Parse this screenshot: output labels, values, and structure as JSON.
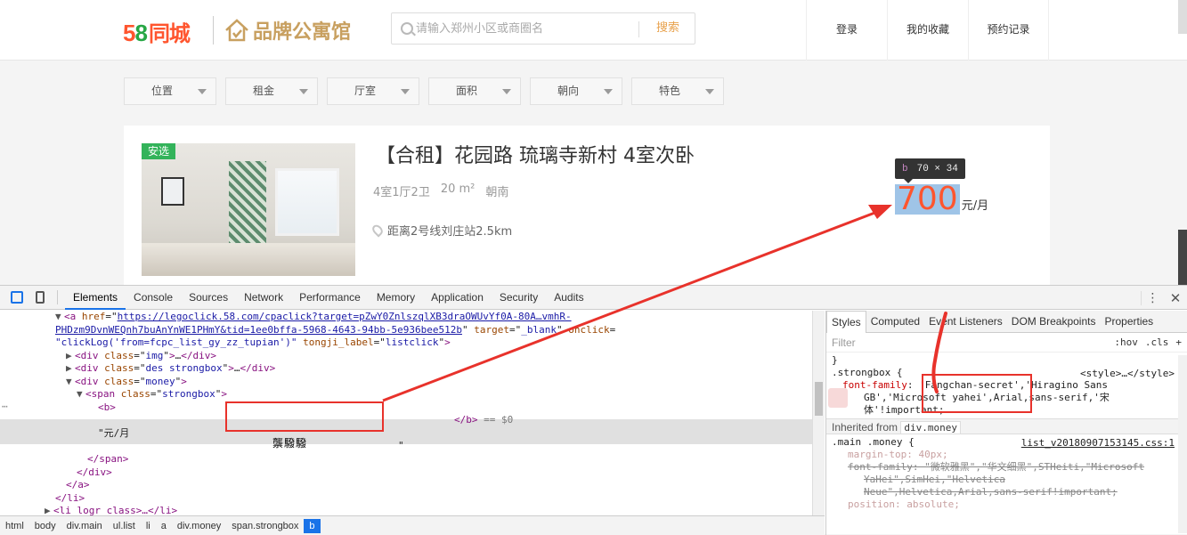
{
  "header": {
    "logo_num": "58",
    "logo_text": "同城",
    "brand_text": "品牌公寓馆",
    "search_placeholder": "请输入郑州小区或商圈名",
    "search_button": "搜索",
    "nav": [
      "登录",
      "我的收藏",
      "预约记录"
    ]
  },
  "filters": [
    "位置",
    "租金",
    "厅室",
    "面积",
    "朝向",
    "特色"
  ],
  "listing": {
    "badge": "安选",
    "title": "【合租】花园路 琉璃寺新村 4室次卧",
    "layout": "4室1厅2卫",
    "area": "20 m²",
    "orientation": "朝南",
    "location": "距离2号线刘庄站2.5km",
    "price": "700",
    "price_unit": "元/月"
  },
  "tooltip": {
    "tag": "b",
    "size": "70 × 34"
  },
  "devtools": {
    "tabs": [
      "Elements",
      "Console",
      "Sources",
      "Network",
      "Performance",
      "Memory",
      "Application",
      "Security",
      "Audits"
    ],
    "active_tab": "Elements",
    "elements": {
      "a_href": "https://legoclick.58.com/cpaclick?target=pZwY0ZnlszqlXB3draOWUvYf0A-80A…vmhR-",
      "a_href2": "PHDzm9DvnWEQnh7buAnYnWE1PHmY&tid=1ee0bffa-5968-4643-94bb-5e936bee512b",
      "a_target": "_blank",
      "a_onclick": "\"clickLog('from=fcpc_list_gy_zz_tupian')\"",
      "a_tongji": "listclick",
      "div_img": "img",
      "div_des": "des strongbox",
      "div_money": "money",
      "span_class": "strongbox",
      "garbled": "龒驋驋",
      "eq": "== $0",
      "text_node": "\"元/月",
      "quote": "\"",
      "collapsed_li": "li logr class"
    },
    "breadcrumbs": [
      "html",
      "body",
      "div.main",
      "ul.list",
      "li",
      "a",
      "div.money",
      "span.strongbox",
      "b"
    ],
    "styles": {
      "tabs": [
        "Styles",
        "Computed",
        "Event Listeners",
        "DOM Breakpoints",
        "Properties"
      ],
      "filter_placeholder": "Filter",
      "hov": ":hov",
      "cls": ".cls",
      "plus": "+",
      "rule1_selector": ".strongbox {",
      "rule1_source": "<style>…</style>",
      "rule1_prop": "font-family",
      "rule1_val_a": "'Fangchan-secret','Hiragino Sans",
      "rule1_val_b": "GB','Microsoft yahei',Arial,sans-serif,'宋",
      "rule1_val_c": "体'!important;",
      "inherited_label": "Inherited from",
      "inherited_from": "div.money",
      "rule2_selector": ".main .money {",
      "rule2_source": "list_v20180907153145.css:1",
      "rule2_p1": "margin-top: 40px;",
      "rule2_p2a": "font-family: \"微软雅黑\",\"华文细黑\",STHeiti,\"Microsoft",
      "rule2_p2b": "YaHei\",SimHei,\"Helvetica",
      "rule2_p2c": "Neue\",Helvetica,Arial,sans-serif!important;",
      "rule2_p3": "position: absolute;"
    }
  },
  "colors": {
    "accent": "#ff552e",
    "green": "#33b35a",
    "highlight": "#9fc4e7",
    "annotation": "#e8322b"
  }
}
